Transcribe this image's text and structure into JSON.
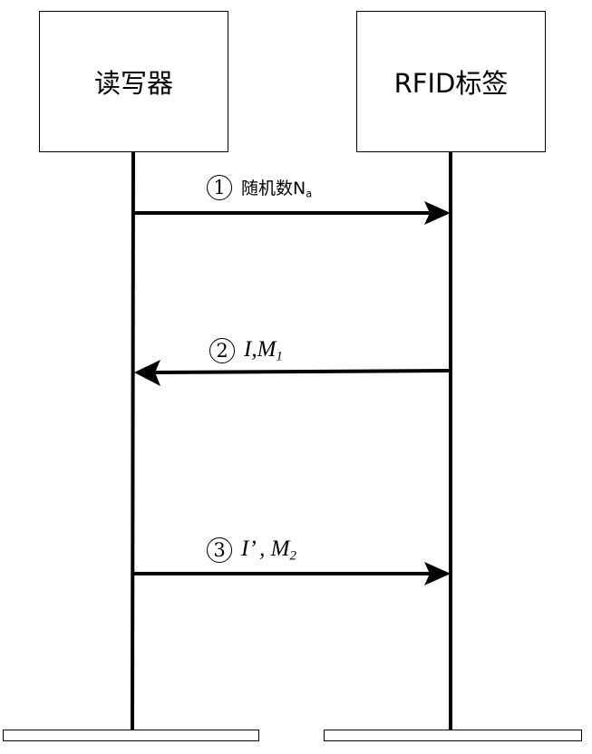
{
  "participants": [
    {
      "id": "reader",
      "label": "读写器"
    },
    {
      "id": "tag",
      "label": "RFID标签"
    }
  ],
  "messages": [
    {
      "step": "1",
      "step_glyph": "①",
      "direction": "reader-to-tag",
      "text": "随机数N",
      "subscript": "a"
    },
    {
      "step": "2",
      "step_glyph": "②",
      "direction": "tag-to-reader",
      "text": "I,M",
      "subscript": "1"
    },
    {
      "step": "3",
      "step_glyph": "③",
      "direction": "reader-to-tag",
      "text": "I’ , M",
      "subscript": "2"
    }
  ],
  "colors": {
    "stroke": "#000000",
    "background": "#ffffff"
  }
}
